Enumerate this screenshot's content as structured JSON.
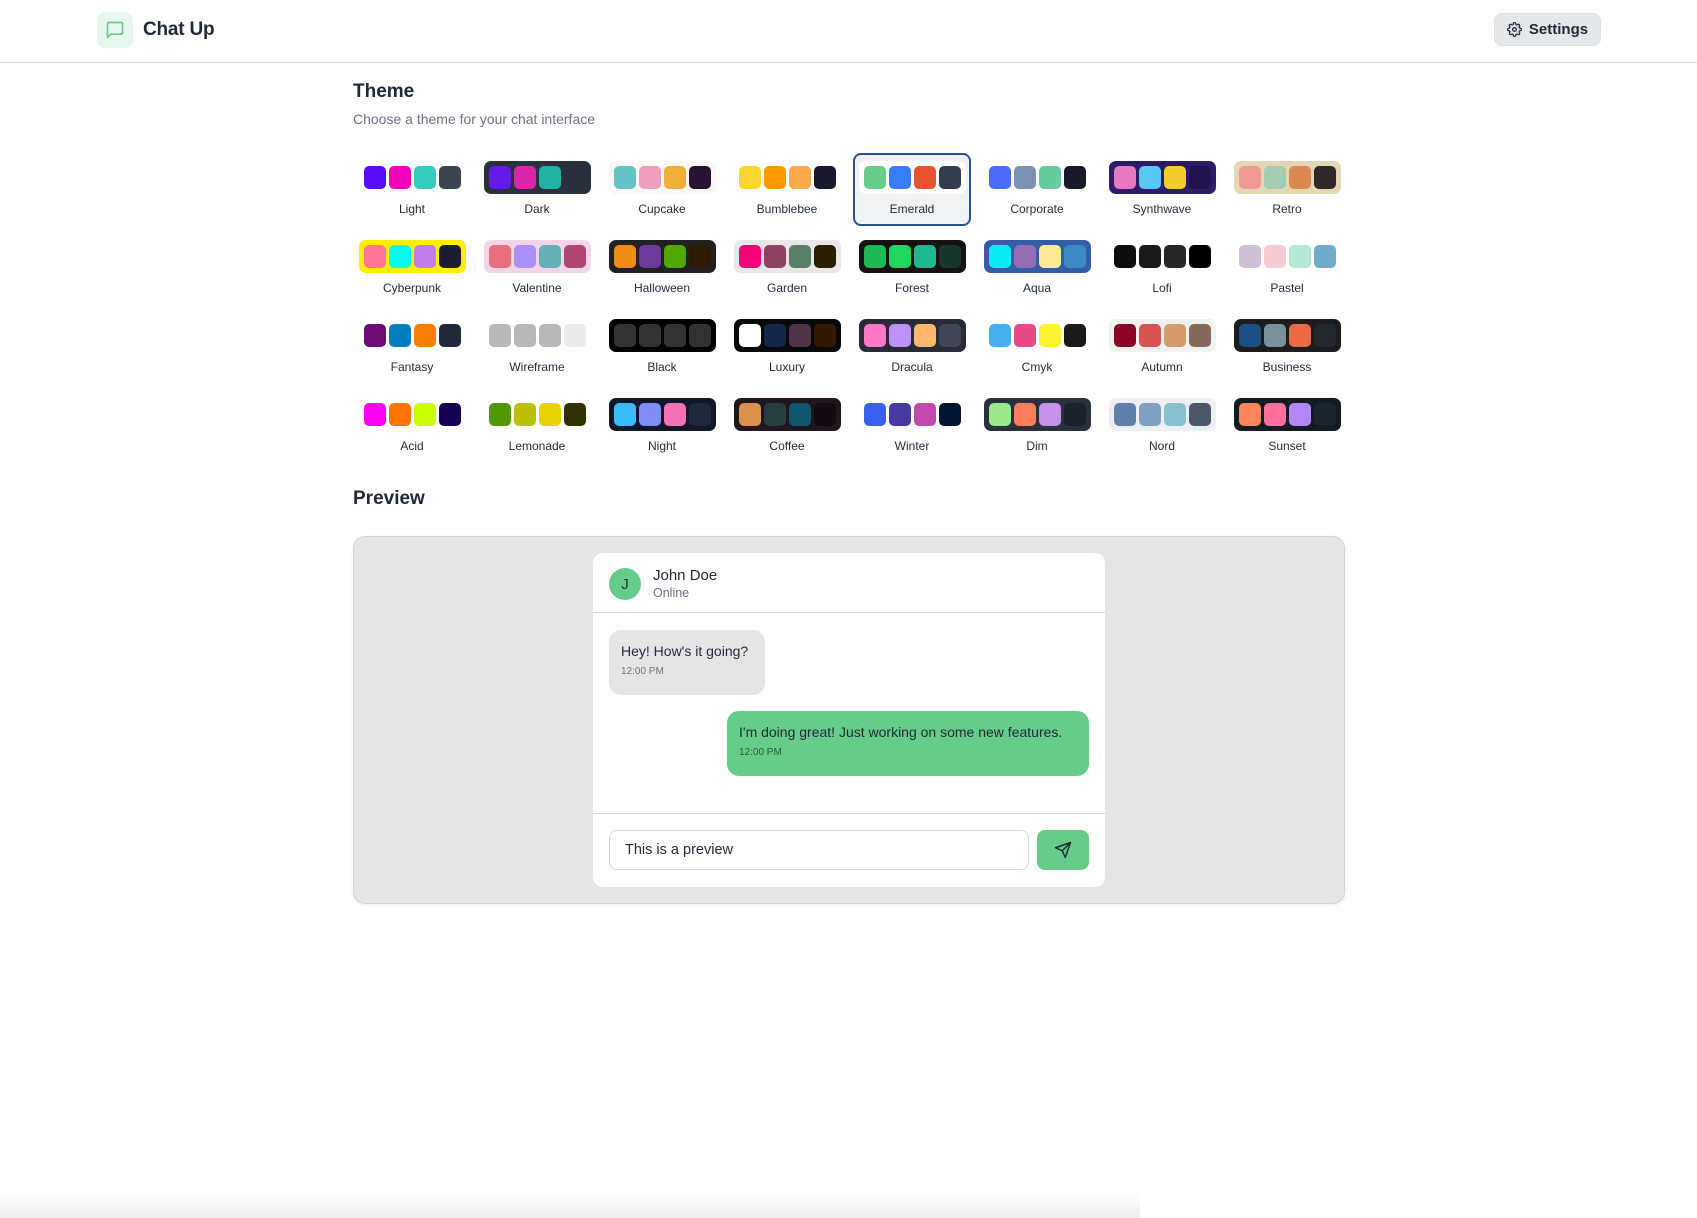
{
  "navbar": {
    "app_title": "Chat Up",
    "logo_icon": "message-square-icon",
    "settings_label": "Settings",
    "settings_icon": "gear-icon"
  },
  "theme_section": {
    "title": "Theme",
    "subtitle": "Choose a theme for your chat interface",
    "selected": "Emerald",
    "themes": [
      {
        "label": "Light",
        "bg": "#ffffff",
        "colors": [
          "#570df8",
          "#f000b8",
          "#37cdbe",
          "#3d4451"
        ]
      },
      {
        "label": "Dark",
        "bg": "#2a303c",
        "colors": [
          "#661ae6",
          "#d926aa",
          "#1fb2a5",
          "#2a303c"
        ]
      },
      {
        "label": "Cupcake",
        "bg": "#faf7f5",
        "colors": [
          "#65c3c8",
          "#ef9fbc",
          "#eeaf3a",
          "#291334"
        ]
      },
      {
        "label": "Bumblebee",
        "bg": "#ffffff",
        "colors": [
          "#f9d72f",
          "#ff9900",
          "#ffa94d",
          "#181830"
        ]
      },
      {
        "label": "Emerald",
        "bg": "#ffffff",
        "colors": [
          "#66cc8a",
          "#377cfb",
          "#ea5234",
          "#333c4d"
        ]
      },
      {
        "label": "Corporate",
        "bg": "#ffffff",
        "colors": [
          "#4b6bfb",
          "#7b92b2",
          "#67cba0",
          "#181a2a"
        ]
      },
      {
        "label": "Synthwave",
        "bg": "#2d1b69",
        "colors": [
          "#e779c1",
          "#58c7f3",
          "#f3cc30",
          "#20134e"
        ]
      },
      {
        "label": "Retro",
        "bg": "#e4d8b4",
        "colors": [
          "#ef9995",
          "#a4cbb4",
          "#dc8850",
          "#2e282a"
        ]
      },
      {
        "label": "Cyberpunk",
        "bg": "#ffee00",
        "colors": [
          "#ff7598",
          "#00ffee",
          "#c07eec",
          "#1c1c33"
        ]
      },
      {
        "label": "Valentine",
        "bg": "#f0d6e8",
        "colors": [
          "#e96d7b",
          "#a991f7",
          "#66b1b3",
          "#af4670"
        ]
      },
      {
        "label": "Halloween",
        "bg": "#212121",
        "colors": [
          "#f28c18",
          "#6d3a9c",
          "#51a800",
          "#2f1b05"
        ]
      },
      {
        "label": "Garden",
        "bg": "#e9e7e7",
        "colors": [
          "#f40076",
          "#8e4162",
          "#5c7f67",
          "#291e00"
        ]
      },
      {
        "label": "Forest",
        "bg": "#171212",
        "colors": [
          "#1eb854",
          "#1fd65f",
          "#1db990",
          "#19362d"
        ]
      },
      {
        "label": "Aqua",
        "bg": "#345da7",
        "colors": [
          "#09ecf3",
          "#966fb3",
          "#ffe999",
          "#3b8ac4"
        ]
      },
      {
        "label": "Lofi",
        "bg": "#ffffff",
        "colors": [
          "#0d0d0d",
          "#1a1919",
          "#262626",
          "#000000"
        ]
      },
      {
        "label": "Pastel",
        "bg": "#ffffff",
        "colors": [
          "#d1c1d7",
          "#f6cbd1",
          "#b4e9d6",
          "#70acc7"
        ]
      },
      {
        "label": "Fantasy",
        "bg": "#ffffff",
        "colors": [
          "#6e0b75",
          "#007ebd",
          "#f87f00",
          "#1f2937"
        ]
      },
      {
        "label": "Wireframe",
        "bg": "#ffffff",
        "colors": [
          "#b8b8b8",
          "#b8b8b8",
          "#b8b8b8",
          "#ebebeb"
        ]
      },
      {
        "label": "Black",
        "bg": "#000000",
        "colors": [
          "#343232",
          "#343232",
          "#343232",
          "#343232"
        ]
      },
      {
        "label": "Luxury",
        "bg": "#09090b",
        "colors": [
          "#ffffff",
          "#152747",
          "#513448",
          "#331800"
        ]
      },
      {
        "label": "Dracula",
        "bg": "#282a36",
        "colors": [
          "#ff79c6",
          "#bd93f9",
          "#ffb86c",
          "#414558"
        ]
      },
      {
        "label": "Cmyk",
        "bg": "#ffffff",
        "colors": [
          "#45aeee",
          "#e8488a",
          "#fff232",
          "#1a1a1a"
        ]
      },
      {
        "label": "Autumn",
        "bg": "#f1f1f1",
        "colors": [
          "#8c0327",
          "#d85251",
          "#d59b6a",
          "#826a5c"
        ]
      },
      {
        "label": "Business",
        "bg": "#1c1c1c",
        "colors": [
          "#1c4e80",
          "#7c909a",
          "#ea6947",
          "#23282e"
        ]
      },
      {
        "label": "Acid",
        "bg": "#ffffff",
        "colors": [
          "#ff00f4",
          "#ff7400",
          "#cbfd03",
          "#140152"
        ]
      },
      {
        "label": "Lemonade",
        "bg": "#ffffff",
        "colors": [
          "#519903",
          "#bbc000",
          "#e8d200",
          "#2f3102"
        ]
      },
      {
        "label": "Night",
        "bg": "#0f1729",
        "colors": [
          "#38bdf8",
          "#818cf8",
          "#f471b5",
          "#1e293b"
        ]
      },
      {
        "label": "Coffee",
        "bg": "#20161f",
        "colors": [
          "#db924b",
          "#263e3f",
          "#10576d",
          "#120c12"
        ]
      },
      {
        "label": "Winter",
        "bg": "#ffffff",
        "colors": [
          "#3a60ed",
          "#463aa2",
          "#c148ac",
          "#021431"
        ]
      },
      {
        "label": "Dim",
        "bg": "#2a303c",
        "colors": [
          "#9fe88d",
          "#ff7d5c",
          "#c792e9",
          "#1c212b"
        ]
      },
      {
        "label": "Nord",
        "bg": "#eceff4",
        "colors": [
          "#5e81ac",
          "#81a1c1",
          "#88c0d0",
          "#4c566a"
        ]
      },
      {
        "label": "Sunset",
        "bg": "#121c22",
        "colors": [
          "#ff865b",
          "#fd6f9c",
          "#b387fa",
          "#1b262c"
        ]
      }
    ]
  },
  "preview": {
    "title": "Preview",
    "contact": {
      "initial": "J",
      "name": "John Doe",
      "status": "Online"
    },
    "messages": [
      {
        "text": "Hey! How's it going?",
        "time": "12:00 PM",
        "direction": "incoming"
      },
      {
        "text": "I'm doing great! Just working on some new features.",
        "time": "12:00 PM",
        "direction": "outgoing"
      }
    ],
    "input_value": "This is a preview",
    "send_icon": "send-icon",
    "accent_color": "#66cc8a"
  }
}
